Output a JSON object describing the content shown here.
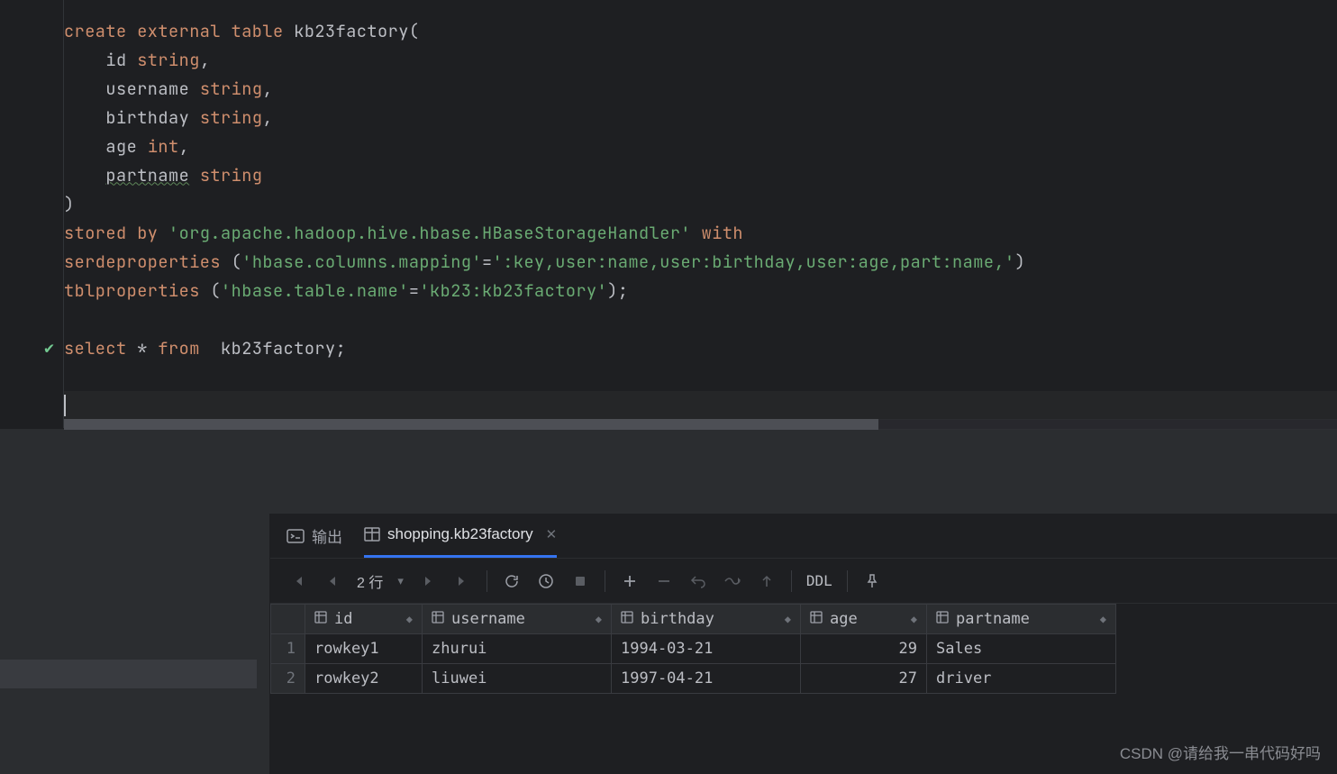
{
  "code": {
    "lines": [
      {
        "tokens": [
          [
            "kw",
            "create "
          ],
          [
            "kw",
            "external "
          ],
          [
            "kw",
            "table "
          ],
          [
            "ident",
            "kb23factory"
          ],
          [
            "paren",
            "("
          ]
        ]
      },
      {
        "tokens": [
          [
            "ident",
            "    id "
          ],
          [
            "type",
            "string"
          ],
          [
            "paren",
            ","
          ]
        ]
      },
      {
        "tokens": [
          [
            "ident",
            "    username "
          ],
          [
            "type",
            "string"
          ],
          [
            "paren",
            ","
          ]
        ]
      },
      {
        "tokens": [
          [
            "ident",
            "    birthday "
          ],
          [
            "type",
            "string"
          ],
          [
            "paren",
            ","
          ]
        ]
      },
      {
        "tokens": [
          [
            "ident",
            "    age "
          ],
          [
            "type",
            "int"
          ],
          [
            "paren",
            ","
          ]
        ]
      },
      {
        "tokens": [
          [
            "ident",
            "    "
          ],
          [
            "warn",
            "partname"
          ],
          [
            "ident",
            " "
          ],
          [
            "type",
            "string"
          ]
        ]
      },
      {
        "tokens": [
          [
            "paren",
            ")"
          ]
        ]
      },
      {
        "tokens": [
          [
            "kw",
            "stored by "
          ],
          [
            "str",
            "'org.apache.hadoop.hive.hbase.HBaseStorageHandler'"
          ],
          [
            "kw",
            " with"
          ]
        ]
      },
      {
        "tokens": [
          [
            "kw",
            "serdeproperties "
          ],
          [
            "paren",
            "("
          ],
          [
            "str",
            "'hbase.columns.mapping'"
          ],
          [
            "op",
            "="
          ],
          [
            "str",
            "':key,user:name,user:birthday,user:age,part:name,'"
          ],
          [
            "paren",
            ")"
          ]
        ]
      },
      {
        "tokens": [
          [
            "kw",
            "tblproperties "
          ],
          [
            "paren",
            "("
          ],
          [
            "str",
            "'hbase.table.name'"
          ],
          [
            "op",
            "="
          ],
          [
            "str",
            "'kb23:kb23factory'"
          ],
          [
            "paren",
            ")"
          ],
          [
            "op",
            ";"
          ]
        ]
      },
      {
        "tokens": []
      },
      {
        "tokens": [
          [
            "kw",
            "select "
          ],
          [
            "op",
            "* "
          ],
          [
            "kw",
            "from  "
          ],
          [
            "ident",
            "kb23factory"
          ],
          [
            "op",
            ";"
          ]
        ],
        "check": true
      },
      {
        "tokens": []
      },
      {
        "tokens": [],
        "caret": true
      }
    ]
  },
  "tabs": {
    "output_label": "输出",
    "result_label": "shopping.kb23factory"
  },
  "toolbar": {
    "row_count_label": "2 行",
    "ddl_label": "DDL"
  },
  "table": {
    "columns": [
      "id",
      "username",
      "birthday",
      "age",
      "partname"
    ],
    "rows": [
      {
        "n": 1,
        "id": "rowkey1",
        "username": "zhurui",
        "birthday": "1994-03-21",
        "age": 29,
        "partname": "Sales"
      },
      {
        "n": 2,
        "id": "rowkey2",
        "username": "liuwei",
        "birthday": "1997-04-21",
        "age": 27,
        "partname": "driver"
      }
    ]
  },
  "watermark": "CSDN @请给我一串代码好吗"
}
